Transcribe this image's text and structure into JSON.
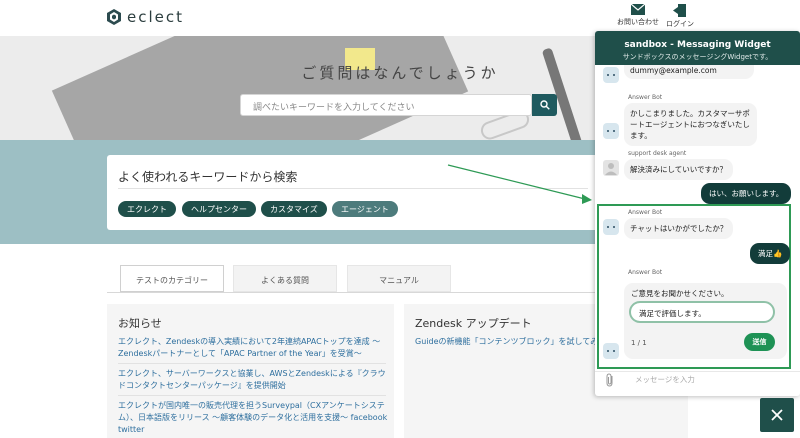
{
  "header": {
    "logo_text": "eclect",
    "contact_label": "お問い合わせ",
    "login_label": "ログイン"
  },
  "hero": {
    "title": "ご質問はなんでしょうか",
    "search_placeholder": "調べたいキーワードを入力してください"
  },
  "keywords": {
    "title": "よく使われるキーワードから検索",
    "tags": [
      "エクレクト",
      "ヘルプセンター",
      "カスタマイズ",
      "エージェント"
    ]
  },
  "tabs": [
    "テストのカテゴリー",
    "よくある質問",
    "マニュアル"
  ],
  "news": {
    "title": "お知らせ",
    "items": [
      "エクレクト、Zendeskの導入実績において2年連続APACトップを達成 〜Zendeskパートナーとして「APAC Partner of the Year」を受賞〜",
      "エクレクト、サーバーワークスと協業し、AWSとZendeskによる『クラウドコンタクトセンターパッケージ』を提供開始",
      "エクレクトが国内唯一の販売代理を担うSurveypal（CXアンケートシステム）、日本語版をリリース 〜顧客体験のデータ化と活用を支援〜 facebook twitter"
    ]
  },
  "updates": {
    "title": "Zendesk アップデート",
    "item": "Guideの新機能「コンテンツブロック」を試してみた"
  },
  "widget": {
    "title": "sandbox - Messaging Widget",
    "subtitle": "サンドボックスのメッセージングWidgetです。",
    "partial_message": "dummy@example.com",
    "messages": [
      {
        "sender": "Answer Bot",
        "text": "かしこまりました。カスタマーサポートエージェントにおつなぎいたします。"
      },
      {
        "sender": "support desk agent",
        "text": "解決済みにしていいですか？"
      },
      {
        "sender": "user",
        "text": "はい、お願いします。"
      },
      {
        "sender": "Answer Bot",
        "text": "チャットはいかがでしたか？"
      },
      {
        "sender": "user",
        "text": "満足👍"
      },
      {
        "sender": "Answer Bot",
        "text": ""
      }
    ],
    "form": {
      "label": "ご意見をお聞かせください。",
      "value": "満足で評価します。",
      "count": "1 / 1",
      "send_label": "送信"
    },
    "input_placeholder": "メッセージを入力"
  },
  "colors": {
    "brand": "#1f4f4a",
    "band": "#9dbfc4",
    "highlight": "#2e9a55",
    "send": "#1e9255"
  }
}
